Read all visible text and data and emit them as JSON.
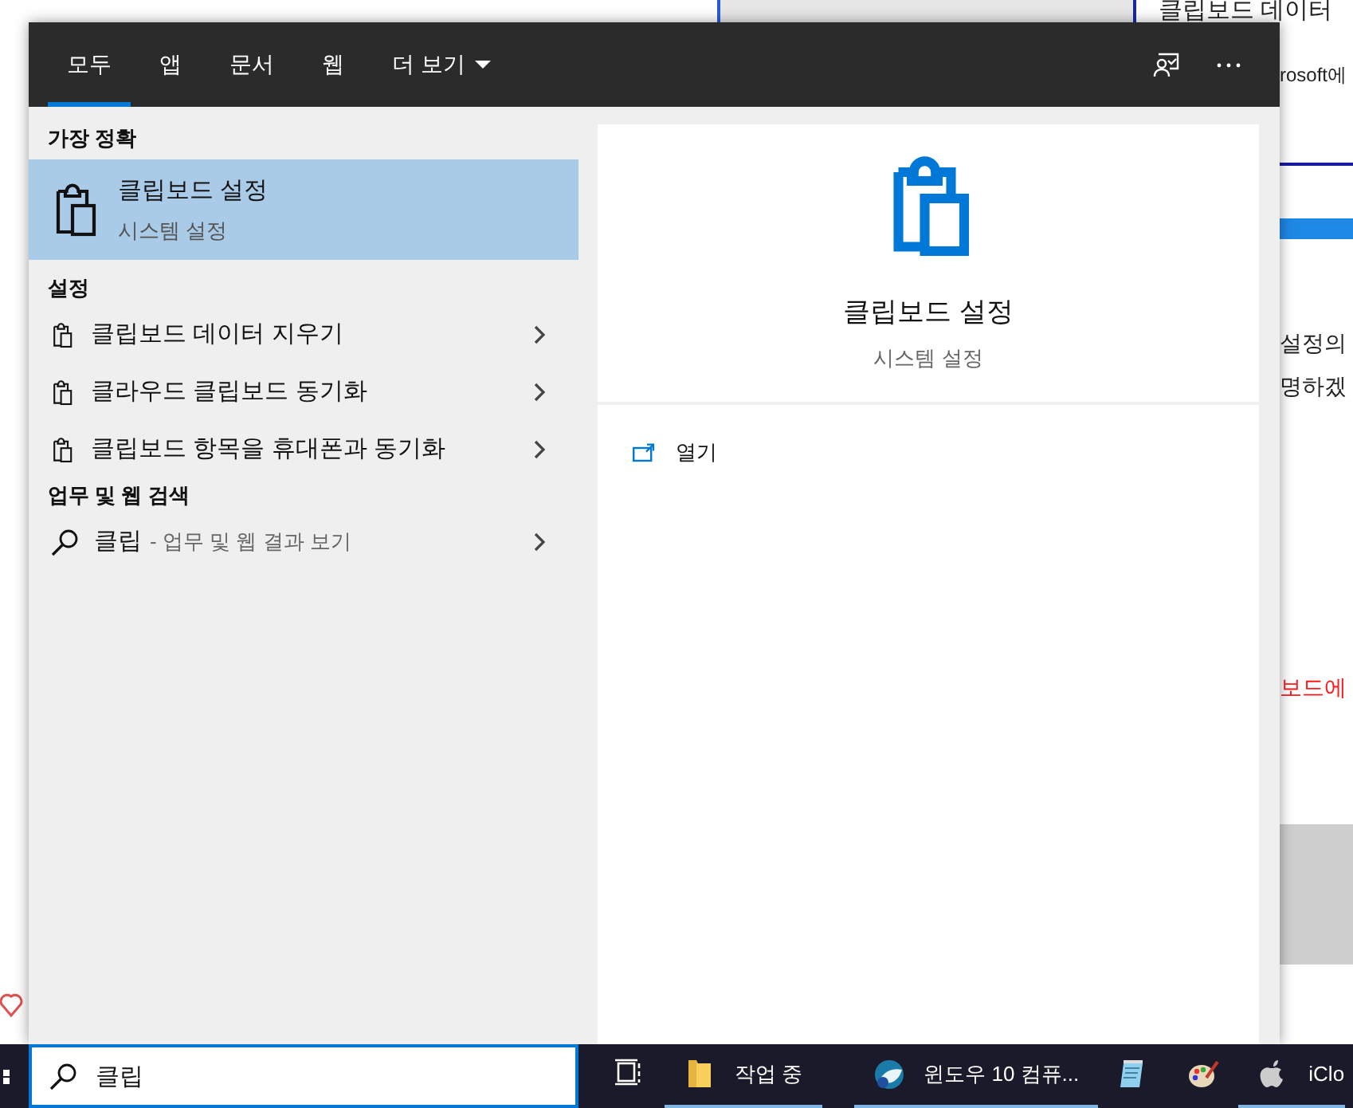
{
  "background_page": {
    "texts": [
      {
        "text": "클립보드 데이터",
        "kind": "heading"
      },
      {
        "text": "rosoft에",
        "kind": "body"
      },
      {
        "text": "설정의",
        "kind": "body"
      },
      {
        "text": "명하겠",
        "kind": "body"
      },
      {
        "text": "보드에",
        "kind": "highlight"
      }
    ]
  },
  "tabs": [
    {
      "label": "모두",
      "kind": "tab",
      "selected": true
    },
    {
      "label": "앱",
      "kind": "tab",
      "selected": false
    },
    {
      "label": "문서",
      "kind": "tab",
      "selected": false
    },
    {
      "label": "웹",
      "kind": "tab",
      "selected": false
    },
    {
      "label": "더 보기",
      "kind": "dropdown",
      "selected": false
    }
  ],
  "best_match": {
    "heading": "가장 정확",
    "title": "클립보드 설정",
    "subtitle": "시스템 설정",
    "selected": true
  },
  "settings": {
    "heading": "설정",
    "items": [
      {
        "label": "클립보드 데이터 지우기"
      },
      {
        "label": "클라우드 클립보드 동기화"
      },
      {
        "label": "클립보드 항목을 휴대폰과 동기화"
      }
    ]
  },
  "web_search": {
    "heading": "업무 및 웹 검색",
    "query": "클립",
    "hint": "- 업무 및 웹 결과 보기"
  },
  "preview": {
    "title": "클립보드 설정",
    "subtitle": "시스템 설정",
    "actions": [
      {
        "label": "열기"
      }
    ]
  },
  "search_box": {
    "value": "클립"
  },
  "taskbar": {
    "items": [
      {
        "kind": "taskview",
        "running": false
      },
      {
        "kind": "folder",
        "label": "작업 중",
        "running": true
      },
      {
        "kind": "browser",
        "label": "윈도우 10 컴퓨...",
        "running": true
      },
      {
        "kind": "notepad",
        "running": false
      },
      {
        "kind": "paint",
        "running": false
      },
      {
        "kind": "apple",
        "label": "iClo",
        "running": true
      }
    ]
  }
}
